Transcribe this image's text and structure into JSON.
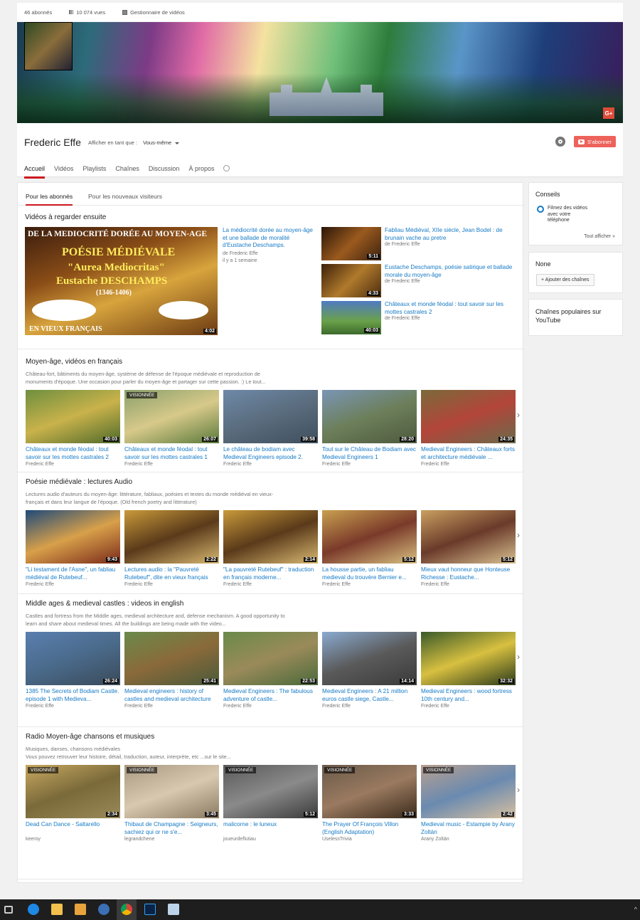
{
  "stats": {
    "subscribers": "46 abonnés",
    "views": "10 074 vues",
    "manager": "Gestionnaire de vidéos"
  },
  "channel": {
    "name": "Frederic Effe",
    "view_as_label": "Afficher en tant que :",
    "view_as_value": "Vous-même",
    "subscribe": "S'abonner"
  },
  "nav": {
    "tabs": [
      "Accueil",
      "Vidéos",
      "Playlists",
      "Chaînes",
      "Discussion",
      "À propos"
    ]
  },
  "subtabs": [
    "Pour les abonnés",
    "Pour les nouveaux visiteurs"
  ],
  "featured": {
    "title": "Vidéos à regarder ensuite",
    "main": {
      "title": "La médiocrité dorée au moyen-âge et une ballade de moralité d'Eustache Deschamps.",
      "by": "de Frederic Effe",
      "age": "il y a 1 semaine",
      "duration": "4:02",
      "thumb_text": [
        "DE LA MEDIOCRITÉ DORÉE AU MOYEN-AGE",
        "POÉSIE MÉDIÉVALE",
        "\"Aurea Mediocritas\"",
        "Eustache DESCHAMPS",
        "(1346-1406)",
        "EN VIEUX FRANÇAIS"
      ]
    },
    "side": [
      {
        "title": "Fabliau Médiéval, XIIe siècle, Jean Bodel : de brunain vache au pretre",
        "by": "de Frederic Effe",
        "duration": "5:11"
      },
      {
        "title": "Eustache Deschamps, poésie satirique et ballade morale du moyen-âge",
        "by": "de Frederic Effe",
        "duration": "4:33"
      },
      {
        "title": "Châteaux et monde féodal : tout savoir sur les mottes castrales 2",
        "by": "de Frederic Effe",
        "duration": "40:03"
      }
    ]
  },
  "sections": [
    {
      "title": "Moyen-âge, vidéos en français",
      "desc": "Château-fort, bâtiments du moyen-âge, système de défense de l'époque médiévale et reproduction de monuments d'époque. Une occasion pour parler du moyen-âge et partager sur cette passion. :) Le tout...",
      "videos": [
        {
          "title": "Châteaux et monde féodal : tout savoir sur les mottes castrales 2",
          "by": "Frederic Effe",
          "duration": "40:03",
          "watched": ""
        },
        {
          "title": "Châteaux et monde féodal : tout savoir sur les mottes castrales 1",
          "by": "Frederic Effe",
          "duration": "26:07",
          "watched": "VISIONNÉE"
        },
        {
          "title": "Le château de bodiam avec Medieval Engineers episode 2.",
          "by": "Frederic Effe",
          "duration": "39:58",
          "watched": ""
        },
        {
          "title": "Tout sur le Château de Bodiam avec Medieval Engineers 1",
          "by": "Frederic Effe",
          "duration": "28:20",
          "watched": ""
        },
        {
          "title": "Medieval Engineers : Châteaux forts et architecture médiévale ...",
          "by": "Frederic Effe",
          "duration": "24:35",
          "watched": ""
        }
      ]
    },
    {
      "title": "Poésie médiévale : lectures Audio",
      "desc": "Lectures audio d'auteurs du moyen-âge: littérature, fabliaux, poésies et textes du monde médiéval en vieux- français et dans leur langue de l'époque. (Old french poetry and litterature)",
      "videos": [
        {
          "title": "\"Li testament de l'Asne\", un fabliau médiéval de Rutebeuf...",
          "by": "Frederic Effe",
          "duration": "9:43",
          "watched": ""
        },
        {
          "title": "Lectures audio : la \"Pauvreté Rutebeuf\", dite en vieux français",
          "by": "Frederic Effe",
          "duration": "2:22",
          "watched": ""
        },
        {
          "title": "\"La pauvreté Rutebeuf\" : traduction en français moderne...",
          "by": "Frederic Effe",
          "duration": "2:14",
          "watched": ""
        },
        {
          "title": "La housse partie, un fabliau medieval du trouvère Bernier e...",
          "by": "Frederic Effe",
          "duration": "5:12",
          "watched": ""
        },
        {
          "title": "Mieux vaut honneur que Honteuse Richesse : Eustache...",
          "by": "Frederic Effe",
          "duration": "5:12",
          "watched": ""
        }
      ]
    },
    {
      "title": "Middle ages & medieval castles : videos in english",
      "desc": "Castles and fortress from the Middle ages, medieval architecture and, defense mechanism. A good opportunity to learn and share about medieval times. All the buildings are being made with the video...",
      "videos": [
        {
          "title": "1385 The Secrets of Bodiam Castle. episode 1 with Medieva...",
          "by": "Frederic Effe",
          "duration": "26:24",
          "watched": ""
        },
        {
          "title": "Medieval engineers : history of castles and medieval architecture",
          "by": "Frederic Effe",
          "duration": "25:41",
          "watched": ""
        },
        {
          "title": "Medieval Engineers : The fabulous adventure of castle...",
          "by": "Frederic Effe",
          "duration": "22:53",
          "watched": ""
        },
        {
          "title": "Medieval Engineers : A 21 million euros castle siege, Castle...",
          "by": "Frederic Effe",
          "duration": "14:14",
          "watched": ""
        },
        {
          "title": "Medieval Engineers : wood fortress 10th century and...",
          "by": "Frederic Effe",
          "duration": "32:32",
          "watched": ""
        }
      ]
    },
    {
      "title": "Radio Moyen-âge chansons et musiques",
      "desc": "Musiques, danses, chansons médiévales\nVous pouvez retrouver leur histoire, détail, traduction, auteur, interprète, etc ...sur le site...",
      "videos": [
        {
          "title": "Dead Can Dance - Saltarello",
          "by": "keeroy",
          "duration": "2:34",
          "watched": "VISIONNÉE"
        },
        {
          "title": "Thibaut de Champagne : Seigneurs, sachiez qui or ne s'e...",
          "by": "legrandchene",
          "duration": "3:45",
          "watched": "VISIONNÉE"
        },
        {
          "title": "malicorne : le luneux",
          "by": "joueurdeflutiau",
          "duration": "5:12",
          "watched": "VISIONNÉE"
        },
        {
          "title": "The Prayer Of François Villon (English Adaptation)",
          "by": "UselessTrivia",
          "duration": "3:33",
          "watched": "VISIONNÉE"
        },
        {
          "title": "Medieval music - Estampie by Arany Zoltán",
          "by": "Arany Zoltán",
          "duration": "2:42",
          "watched": "VISIONNÉE"
        }
      ]
    }
  ],
  "sidebar": {
    "tips_title": "Conseils",
    "tips_item": "Filmez des vidéos avec votre téléphone",
    "show_all": "Tout afficher",
    "none_title": "None",
    "add_channels": "+ Ajouter des chaînes",
    "popular_title": "Chaînes populaires sur YouTube"
  }
}
